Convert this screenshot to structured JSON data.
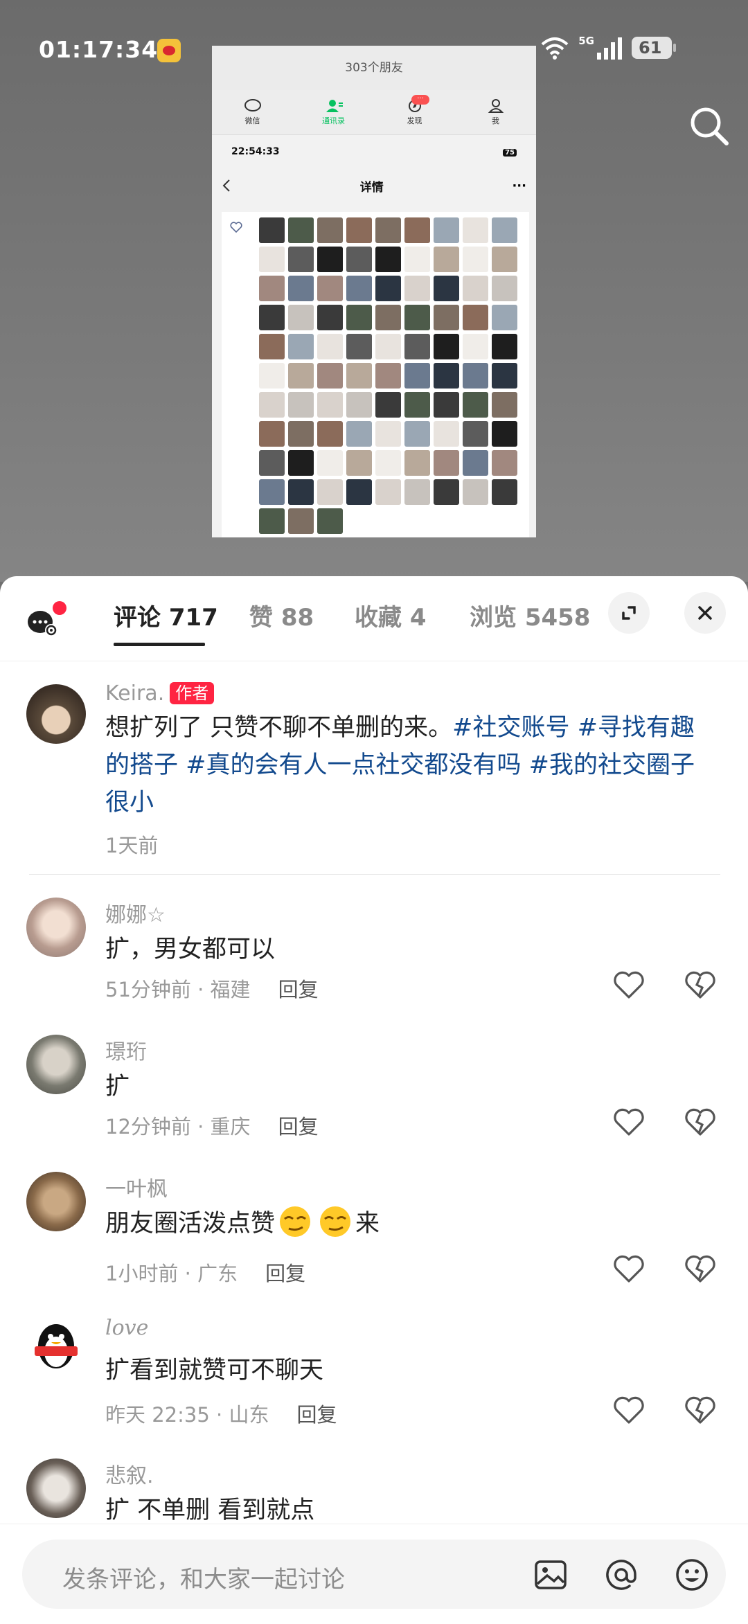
{
  "status_bar": {
    "time": "01:17:34",
    "network": "5G",
    "battery": "61"
  },
  "screenshot": {
    "title": "303个朋友",
    "tabs": [
      {
        "label": "微信"
      },
      {
        "label": "通讯录"
      },
      {
        "label": "发现",
        "badge": "···"
      },
      {
        "label": "我"
      }
    ],
    "time": "22:54:33",
    "battery": "75",
    "nav_title": "详情",
    "nav_more": "···"
  },
  "tabs": [
    {
      "label": "评论 717"
    },
    {
      "label": "赞 88"
    },
    {
      "label": "收藏 4"
    },
    {
      "label": "浏览 5458"
    }
  ],
  "post": {
    "author": "Keira.",
    "author_tag": "作者",
    "text": "想扩列了 只赞不聊不单删的来。",
    "hashtags": [
      "#社交账号",
      "#寻找有趣的搭子",
      "#真的会有人一点社交都没有吗",
      "#我的社交圈子很小"
    ],
    "time": "1天前"
  },
  "comments": [
    {
      "user": "娜娜☆",
      "text": "扩，男女都可以",
      "meta": "51分钟前 · 福建",
      "reply": "回复"
    },
    {
      "user": "璟珩",
      "text": "扩",
      "meta": "12分钟前 · 重庆",
      "reply": "回复"
    },
    {
      "user": "一叶枫",
      "text": "朋友圈活泼点赞",
      "emoji_suffix": "来",
      "meta": "1小时前 · 广东",
      "reply": "回复"
    },
    {
      "user": "love",
      "text": "扩看到就赞可不聊天",
      "meta": "昨天 22:35 · 山东",
      "reply": "回复"
    },
    {
      "user": "悲叙.",
      "text": "扩 不单删 看到就点"
    }
  ],
  "input": {
    "placeholder": "发条评论，和大家一起讨论"
  },
  "colors": {
    "accent_red": "#ff2442",
    "hashtag": "#134a8e",
    "wechat_green": "#07c160"
  }
}
